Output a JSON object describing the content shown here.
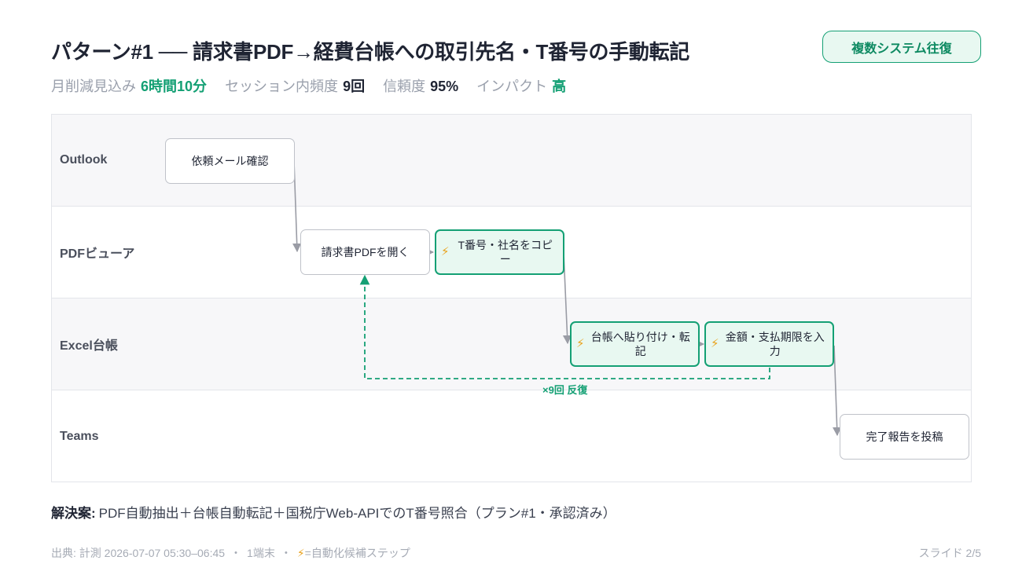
{
  "header": {
    "title": "パターン#1 ── 請求書PDF→経費台帳への取引先名・T番号の手動転記",
    "badge": "複数システム往復"
  },
  "metrics": [
    {
      "label": "月削減見込み",
      "value": "6時間10分",
      "accent": true
    },
    {
      "label": "セッション内頻度",
      "value": "9回",
      "accent": false
    },
    {
      "label": "信頼度",
      "value": "95%",
      "accent": false
    },
    {
      "label": "インパクト",
      "value": "高",
      "accent": true
    }
  ],
  "lanes": [
    "Outlook",
    "PDFビューア",
    "Excel台帳",
    "Teams"
  ],
  "steps": [
    {
      "label": "依頼メール確認",
      "lane": 0,
      "automatable": false
    },
    {
      "label": "請求書PDFを開く",
      "lane": 1,
      "automatable": false
    },
    {
      "label": "T番号・社名をコピー",
      "lane": 1,
      "automatable": true
    },
    {
      "label": "台帳へ貼り付け・転記",
      "lane": 2,
      "automatable": true
    },
    {
      "label": "金額・支払期限を入力",
      "lane": 2,
      "automatable": true
    },
    {
      "label": "完了報告を投稿",
      "lane": 3,
      "automatable": false
    }
  ],
  "loop": {
    "label": "×9回 反復",
    "from_step": 4,
    "to_step": 1
  },
  "auto_icon": "lightning-icon",
  "solution": {
    "label": "解決案:",
    "text": "PDF自動抽出＋台帳自動転記＋国税庁Web-APIでのT番号照合（プラン#1・承認済み）"
  },
  "footer": {
    "source": "出典: 計測 2026-07-07 05:30–06:45",
    "devices": "1端末",
    "separator": "・",
    "bolt": "⚡",
    "legend": "=自動化候補ステップ",
    "slide": "スライド 2/5"
  },
  "colors": {
    "accent": "#14a074",
    "accent_bg": "#e8f8f1",
    "bolt": "#e9a21b",
    "arrow": "#9a9ca5",
    "text": "#1f2433"
  }
}
